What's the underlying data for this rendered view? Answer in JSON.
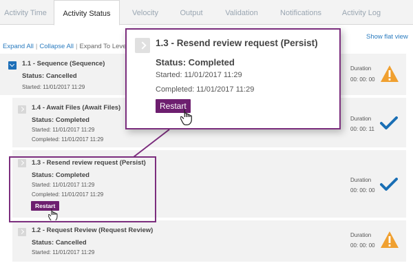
{
  "tabs": [
    {
      "label": "Activity Time"
    },
    {
      "label": "Activity Status"
    },
    {
      "label": "Velocity"
    },
    {
      "label": "Output"
    },
    {
      "label": "Validation"
    },
    {
      "label": "Notifications"
    },
    {
      "label": "Activity Log"
    }
  ],
  "active_tab": "Activity Status",
  "toolbar": {
    "expand_all": "Expand All",
    "collapse_all": "Collapse All",
    "expand_to_level": "Expand To Leve",
    "separator": "|",
    "show_flat_view": "Show flat view"
  },
  "activities": [
    {
      "title": "1.1 - Sequence (Sequence)",
      "status": "Status: Cancelled",
      "started": "Started: 11/01/2017 11:29",
      "duration_label": "Duration",
      "duration": "00: 00: 00",
      "status_icon": "warning-icon"
    },
    {
      "title": "1.4 - Await Files (Await Files)",
      "status": "Status: Completed",
      "started": "Started: 11/01/2017 11:29",
      "completed": "Completed: 11/01/2017 11:29",
      "duration_label": "Duration",
      "duration": "00: 00: 11",
      "status_icon": "check-icon"
    },
    {
      "title": "1.3 - Resend review request (Persist)",
      "status": "Status: Completed",
      "started": "Started: 11/01/2017 11:29",
      "completed": "Completed: 11/01/2017 11:29",
      "restart_label": "Restart",
      "duration_label": "Duration",
      "duration": "00: 00: 00",
      "status_icon": "check-icon"
    },
    {
      "title": "1.2 - Request Review (Request Review)",
      "status": "Status: Cancelled",
      "started": "Started: 11/01/2017 11:29",
      "duration_label": "Duration",
      "duration": "00: 00: 00",
      "status_icon": "warning-icon"
    }
  ],
  "callout": {
    "title": "1.3 - Resend review request (Persist)",
    "status": "Status: Completed",
    "started": "Started: 11/01/2017 11:29",
    "completed": "Completed: 11/01/2017 11:29",
    "restart_label": "Restart"
  },
  "colors": {
    "accent_purple": "#6d1e6f",
    "link_blue": "#2a7bbf",
    "check_blue": "#1a6fb5",
    "warning_orange": "#f0a030"
  }
}
